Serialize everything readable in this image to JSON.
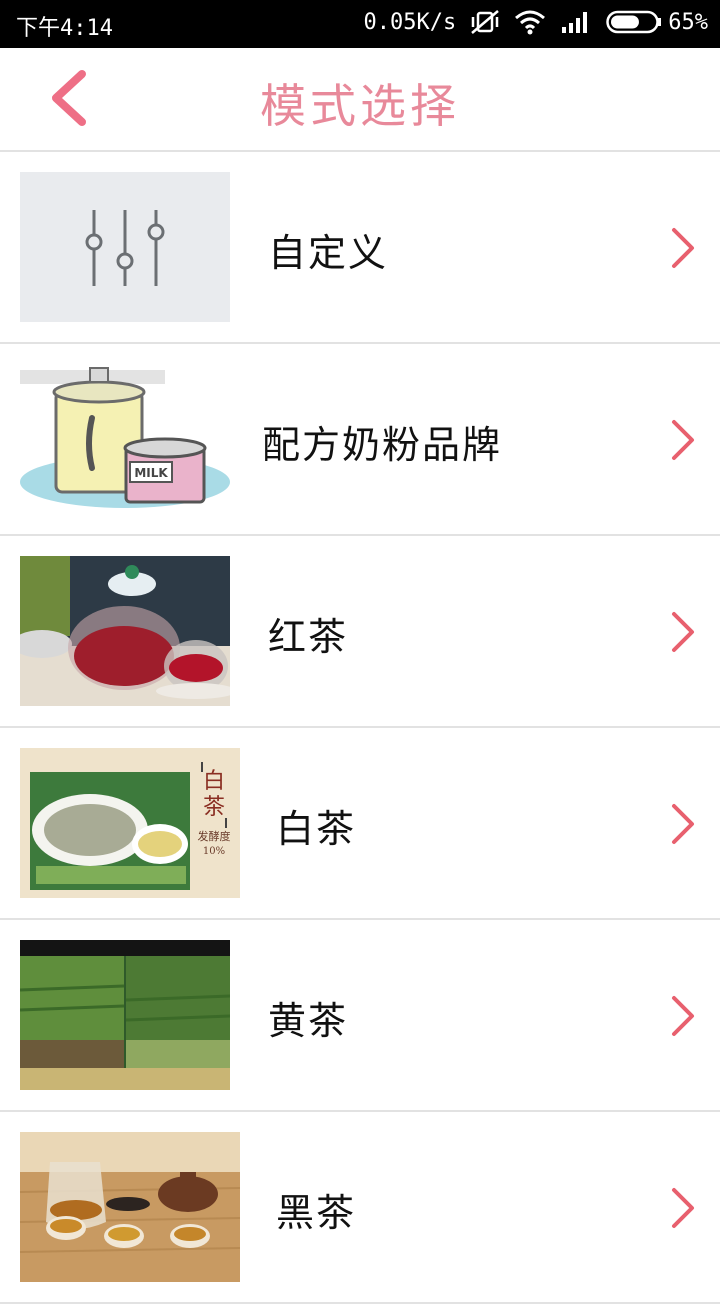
{
  "status_bar": {
    "time": "下午4:14",
    "network_speed": "0.05K/s",
    "battery": "65%",
    "battery_level": 0.65
  },
  "header": {
    "title": "模式选择",
    "back_icon": "chevron-left-icon",
    "accent_color": "#e8899a"
  },
  "items": [
    {
      "label": "自定义",
      "image": "equalizer-sliders"
    },
    {
      "label": "配方奶粉品牌",
      "image": "milk-cans",
      "image_text": "MILK"
    },
    {
      "label": "红茶",
      "image": "red-tea-teapot"
    },
    {
      "label": "白茶",
      "image": "white-tea",
      "image_text": [
        "白",
        "茶",
        "发酵度",
        "10%"
      ]
    },
    {
      "label": "黄茶",
      "image": "tea-plantation"
    },
    {
      "label": "黑茶",
      "image": "black-tea-set"
    }
  ],
  "chevron_color": "#e8606e"
}
